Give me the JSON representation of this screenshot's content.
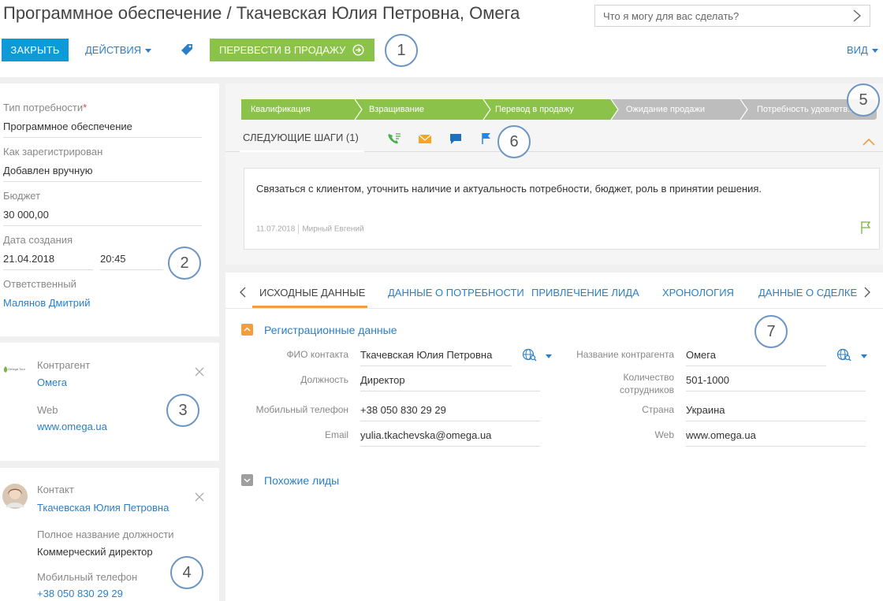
{
  "header": {
    "title": "Программное обеспечение / Ткачевская Юлия Петровна, Омега",
    "search_placeholder": "Что я могу для вас сделать?",
    "close_label": "ЗАКРЫТЬ",
    "actions_label": "ДЕЙСТВИЯ",
    "convert_label": "ПЕРЕВЕСТИ В ПРОДАЖУ",
    "view_label": "ВИД"
  },
  "callouts": [
    "1",
    "2",
    "3",
    "4",
    "5",
    "6",
    "7"
  ],
  "profile": {
    "need_type_label": "Тип потребности",
    "need_type_required": "*",
    "need_type_value": "Программное обеспечение",
    "registered_label": "Как зарегистрирован",
    "registered_value": "Добавлен вручную",
    "budget_label": "Бюджет",
    "budget_value": "30 000,00",
    "created_label": "Дата создания",
    "created_date": "21.04.2018",
    "created_time": "20:45",
    "owner_label": "Ответственный",
    "owner_value": "Малянов Дмитрий"
  },
  "account_card": {
    "logo_text": "Omega Tour",
    "type_label": "Контрагент",
    "name": "Омега",
    "web_label": "Web",
    "web_value": "www.omega.ua"
  },
  "contact_card": {
    "type_label": "Контакт",
    "name": "Ткачевская Юлия Петровна",
    "job_label": "Полное название должности",
    "job_value": "Коммерческий директор",
    "phone_label": "Мобильный телефон",
    "phone_value": "+38 050 830 29 29"
  },
  "stages": [
    {
      "label": "Квалификация",
      "color": "#8bc34a"
    },
    {
      "label": "Взращивание",
      "color": "#8bc34a"
    },
    {
      "label": "Перевод в продажу",
      "color": "#8bc34a"
    },
    {
      "label": "Ожидание продажи",
      "color": "#bdbdbd"
    },
    {
      "label": "Потребность удовлетв...",
      "color": "#bdbdbd"
    }
  ],
  "next_steps": {
    "label": "СЛЕДУЮЩИЕ ШАГИ (1)",
    "task_text": "Связаться с клиентом, уточнить наличие и актуальность потребности, бюджет, роль в принятии решения.",
    "task_date": "11.07.2018",
    "task_owner": "Мирный Евгений"
  },
  "tabs": [
    "ИСХОДНЫЕ ДАННЫЕ",
    "ДАННЫЕ О ПОТРЕБНОСТИ",
    "ПРИВЛЕЧЕНИЕ ЛИДА",
    "ХРОНОЛОГИЯ",
    "ДАННЫЕ О СДЕЛКЕ"
  ],
  "registration": {
    "title": "Регистрационные данные",
    "contact_name_label": "ФИО контакта",
    "contact_name_value": "Ткачевская Юлия Петровна",
    "position_label": "Должность",
    "position_value": "Директор",
    "mobile_label": "Мобильный телефон",
    "mobile_value": "+38 050 830 29 29",
    "email_label": "Email",
    "email_value": "yulia.tkachevska@omega.ua",
    "account_name_label": "Название контрагента",
    "account_name_value": "Омега",
    "employees_label_1": "Количество",
    "employees_label_2": "сотрудников",
    "employees_value": "501-1000",
    "country_label": "Страна",
    "country_value": "Украина",
    "web_label": "Web",
    "web_value": "www.omega.ua"
  },
  "similar": {
    "title": "Похожие лиды"
  },
  "colors": {
    "accent_blue": "#0d9ad6",
    "link_blue": "#2a7fc8",
    "green": "#8bc34a",
    "orange": "#f49d3b",
    "grey_stage": "#bdbdbd"
  }
}
